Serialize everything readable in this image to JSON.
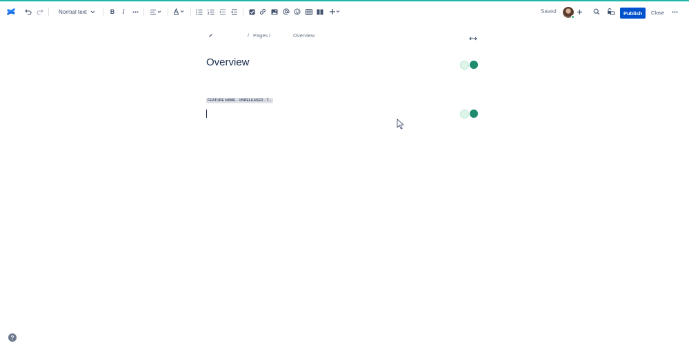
{
  "colors": {
    "accent_line": "#1fb5a8",
    "primary": "#0052cc",
    "presence": "#1e8a6e"
  },
  "toolbar": {
    "text_style": "Normal text",
    "saved_status": "Saved",
    "publish_label": "Publish",
    "close_label": "Close",
    "icons": [
      "confluence-logo-icon",
      "undo-icon",
      "redo-icon",
      "bold-icon",
      "italic-icon",
      "more-formatting-icon",
      "align-icon",
      "text-color-icon",
      "bullet-list-icon",
      "numbered-list-icon",
      "outdent-icon",
      "indent-icon",
      "action-item-icon",
      "link-icon",
      "image-icon",
      "mention-icon",
      "emoji-icon",
      "table-icon",
      "layouts-icon",
      "insert-icon",
      "add-collaborator-icon",
      "search-icon",
      "restrictions-icon",
      "more-icon"
    ]
  },
  "breadcrumb": {
    "items": [
      "Pages",
      "Overview"
    ],
    "separator": "/"
  },
  "page": {
    "title": "Overview",
    "status_lozenge": "FEATURE NAME - UNRELEASED - T..."
  },
  "help": {
    "label": "?"
  }
}
